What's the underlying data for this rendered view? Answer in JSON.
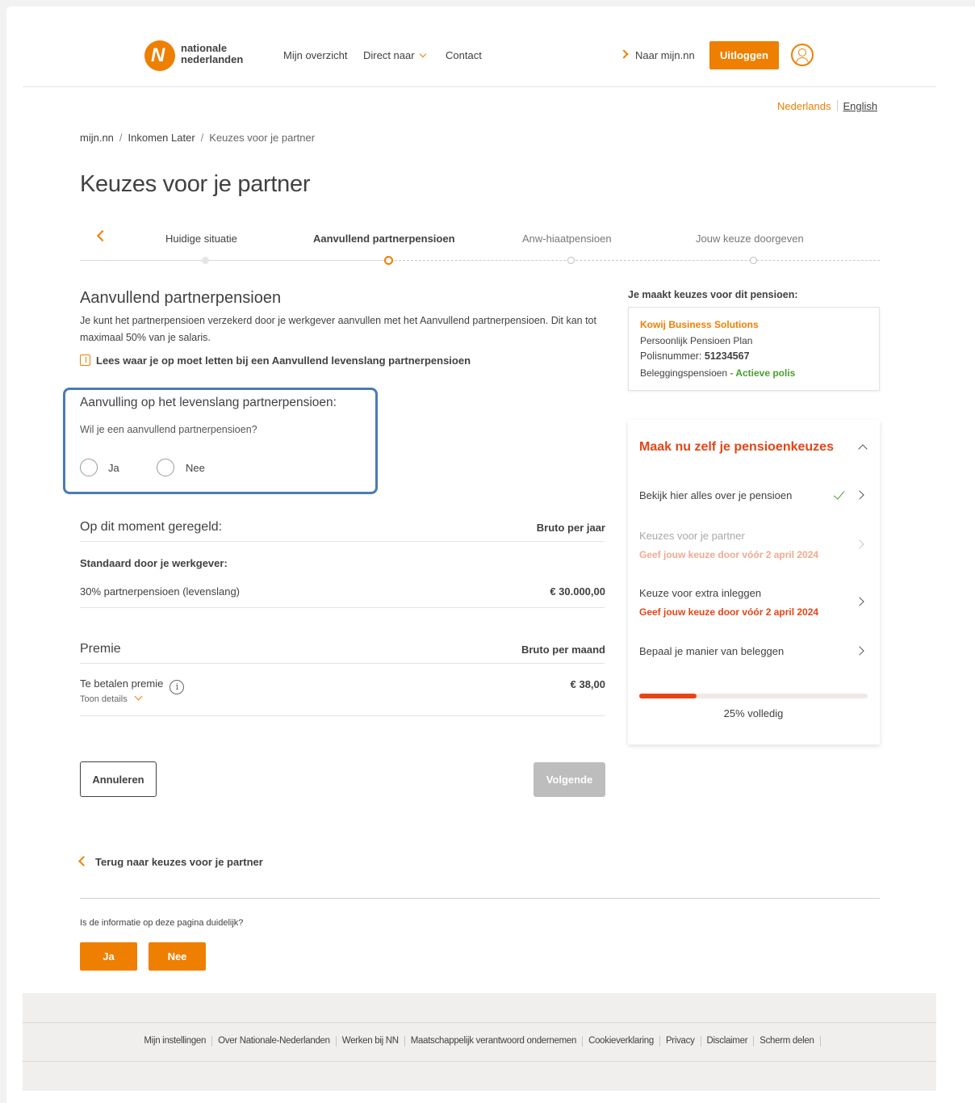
{
  "header": {
    "logo_line1": "nationale",
    "logo_line2": "nederlanden",
    "nav": [
      "Mijn overzicht",
      "Direct naar",
      "Contact"
    ],
    "to_mijn_nn": "Naar mijn.nn",
    "logout": "Uitloggen"
  },
  "lang": {
    "nl": "Nederlands",
    "en": "English"
  },
  "breadcrumb": [
    "mijn.nn",
    "Inkomen Later",
    "Keuzes voor je partner"
  ],
  "page_title": "Keuzes voor je partner",
  "steps": [
    "Huidige situatie",
    "Aanvullend partnerpensioen",
    "Anw-hiaatpensioen",
    "Jouw keuze doorgeven"
  ],
  "main": {
    "heading": "Aanvullend partnerpensioen",
    "intro": "Je kunt het partnerpensioen verzekerd door je werkgever aanvullen met het Aanvullend partnerpensioen. Dit kan tot maximaal 50% van je salaris.",
    "doc_link": "Lees waar je op moet letten bij een Aanvullend levenslang partnerpensioen",
    "question": {
      "title": "Aanvulling op het levenslang partnerpensioen:",
      "sub": "Wil je een aanvullend partnerpensioen?",
      "yes": "Ja",
      "no": "Nee"
    },
    "current": {
      "title": "Op dit moment geregeld:",
      "col": "Bruto per jaar",
      "subtitle": "Standaard door je werkgever:",
      "row_label": "30% partnerpensioen (levenslang)",
      "row_value": "€ 30.000,00"
    },
    "premium": {
      "title": "Premie",
      "col": "Bruto per maand",
      "row_label": "Te betalen premie",
      "row_value": "€ 38,00",
      "details": "Toon details",
      "info": "i"
    },
    "cancel": "Annuleren",
    "next": "Volgende",
    "back": "Terug naar keuzes voor je partner",
    "feedback": {
      "question": "Is de informatie op deze pagina duidelijk?",
      "yes": "Ja",
      "no": "Nee"
    }
  },
  "sidebar": {
    "heading": "Je maakt keuzes voor dit pensioen:",
    "policy": {
      "company": "Kowij Business Solutions",
      "plan": "Persoonlijk Pensioen Plan",
      "number_label": "Polisnummer:",
      "number": "51234567",
      "type": "Beleggingspensioen",
      "status": "- Actieve polis"
    },
    "card": {
      "title": "Maak nu zelf je pensioenkeuzes",
      "tasks": [
        {
          "label": "Bekijk hier alles over je pensioen",
          "due": ""
        },
        {
          "label": "Keuzes voor je partner",
          "due": "Geef jouw keuze door vóór 2 april 2024"
        },
        {
          "label": "Keuze voor extra inleggen",
          "due": "Geef jouw keuze door vóór 2 april 2024"
        },
        {
          "label": "Bepaal je manier van beleggen",
          "due": ""
        }
      ],
      "progress_percent": 25,
      "progress_label": "25% volledig"
    }
  },
  "footer": [
    "Mijn instellingen",
    "Over Nationale-Nederlanden",
    "Werken bij NN",
    "Maatschappelijk verantwoord ondernemen",
    "Cookieverklaring",
    "Privacy",
    "Disclaimer",
    "Scherm delen"
  ],
  "colors": {
    "brand": "#ee7f00",
    "accent_red": "#e64415",
    "focus_blue": "#4b7bb5",
    "active_green": "#4a9e2e"
  }
}
